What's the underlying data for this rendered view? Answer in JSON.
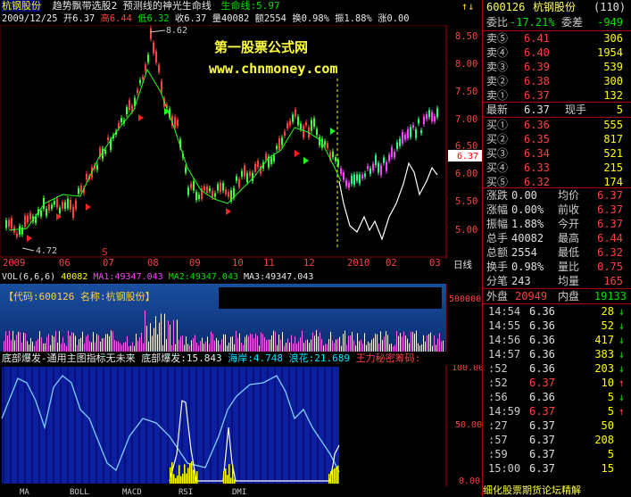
{
  "header": {
    "stock_name": "杭钢股份",
    "title_items": [
      "趋势飘带选股2",
      "预测线的神光生命线"
    ],
    "life_line_label": "生命线:",
    "life_line_value": "5.97",
    "arrow_up": "↑",
    "arrow_down": "↓"
  },
  "quote_line": {
    "date": "2009/12/25",
    "open_label": "开",
    "open": "6.37",
    "high_label": "高",
    "high": "6.44",
    "low_label": "低",
    "low": "6.32",
    "close_label": "收",
    "close": "6.37",
    "volume_label": "量",
    "volume": "40082",
    "amount_label": "额",
    "amount": "2554",
    "turnover_label": "换",
    "turnover": "0.98%",
    "amplitude_label": "振",
    "amplitude": "1.88%",
    "change_label": "涨",
    "change": "0.00"
  },
  "watermark": {
    "line1": "第一股票公式网",
    "line2": "www.chnmoney.com"
  },
  "price_chart": {
    "peak_label": "8.62",
    "trough_label": "4.72",
    "current_tag": "6.37",
    "s_marker": "S",
    "y_ticks": [
      "8.50",
      "8.00",
      "7.50",
      "7.00",
      "6.50",
      "6.00",
      "5.50",
      "5.00"
    ],
    "x_ticks": [
      "2009",
      "06",
      "07",
      "08",
      "09",
      "10",
      "11",
      "12",
      "2010",
      "02",
      "03"
    ],
    "period_label": "日线"
  },
  "volume_panel": {
    "vol_label": "VOL(6,6,6)",
    "vol": "40082",
    "ma1_label": "MA1:",
    "ma1": "49347.043",
    "ma2_label": "MA2:",
    "ma2": "49347.043",
    "ma3_label": "MA3:",
    "ma3": "49347.043",
    "code_label": "【代码:600126 名称:杭钢股份】",
    "y_tick": "500000"
  },
  "indicator_panel": {
    "name": "底部爆发-通用主图指标无未来",
    "label1": "底部爆发:",
    "value1": "15.843",
    "label2": "海岸:",
    "value2": "4.748",
    "label3": "浪花:",
    "value3": "21.689",
    "label4": "王力秘密筹码:",
    "y_ticks": [
      "100.00",
      "50.00",
      "0.00"
    ]
  },
  "bottom_tabs": [
    "MA",
    "BOLL",
    "MACD",
    "RSI",
    "DMI"
  ],
  "right_panel": {
    "code": "600126",
    "name": "杭钢股份",
    "count": "(110)",
    "weibi_label": "委比",
    "weibi": "-17.21%",
    "weicha_label": "委差",
    "weicha": "-949",
    "asks": [
      {
        "label": "卖⑤",
        "price": "6.41",
        "vol": "306"
      },
      {
        "label": "卖④",
        "price": "6.40",
        "vol": "1954"
      },
      {
        "label": "卖③",
        "price": "6.39",
        "vol": "539"
      },
      {
        "label": "卖②",
        "price": "6.38",
        "vol": "300"
      },
      {
        "label": "卖①",
        "price": "6.37",
        "vol": "132"
      }
    ],
    "latest_label": "最新",
    "latest": "6.37",
    "shou_label": "现手",
    "shou": "5",
    "bids": [
      {
        "label": "买①",
        "price": "6.36",
        "vol": "555"
      },
      {
        "label": "买②",
        "price": "6.35",
        "vol": "817"
      },
      {
        "label": "买③",
        "price": "6.34",
        "vol": "521"
      },
      {
        "label": "买④",
        "price": "6.33",
        "vol": "215"
      },
      {
        "label": "买⑤",
        "price": "6.32",
        "vol": "174"
      }
    ],
    "stats": [
      {
        "l1": "涨跌",
        "v1": "0.00",
        "l2": "均价",
        "v2": "6.37"
      },
      {
        "l1": "涨幅",
        "v1": "0.00%",
        "l2": "前收",
        "v2": "6.37"
      },
      {
        "l1": "振幅",
        "v1": "1.88%",
        "l2": "今开",
        "v2": "6.37"
      },
      {
        "l1": "总手",
        "v1": "40082",
        "l2": "最高",
        "v2": "6.44"
      },
      {
        "l1": "总额",
        "v1": "2554",
        "l2": "最低",
        "v2": "6.32"
      },
      {
        "l1": "换手",
        "v1": "0.98%",
        "l2": "量比",
        "v2": "0.75"
      },
      {
        "l1": "分笔",
        "v1": "243",
        "l2": "均量",
        "v2": "165"
      }
    ],
    "outer_label": "外盘",
    "outer": "20949",
    "inner_label": "内盘",
    "inner": "19133",
    "ticks": [
      {
        "time": "14:54",
        "price": "6.36",
        "vol": "28",
        "dir": "↓"
      },
      {
        "time": "14:55",
        "price": "6.36",
        "vol": "52",
        "dir": "↓"
      },
      {
        "time": "14:56",
        "price": "6.36",
        "vol": "417",
        "dir": "↓"
      },
      {
        "time": "14:57",
        "price": "6.36",
        "vol": "383",
        "dir": "↓"
      },
      {
        "time": ":52",
        "price": "6.36",
        "vol": "203",
        "dir": "↓"
      },
      {
        "time": ":52",
        "price": "6.37",
        "vol": "10",
        "dir": "↑"
      },
      {
        "time": ":56",
        "price": "6.36",
        "vol": "5",
        "dir": "↓"
      },
      {
        "time": "14:59",
        "price": "6.37",
        "vol": "5",
        "dir": "↑"
      },
      {
        "time": ":27",
        "price": "6.37",
        "vol": "50",
        "dir": ""
      },
      {
        "time": ":57",
        "price": "6.37",
        "vol": "208",
        "dir": ""
      },
      {
        "time": ":59",
        "price": "6.37",
        "vol": "5",
        "dir": ""
      },
      {
        "time": "15:00",
        "price": "6.37",
        "vol": "15",
        "dir": ""
      }
    ],
    "footer": "细化股票期货论坛精解"
  }
}
